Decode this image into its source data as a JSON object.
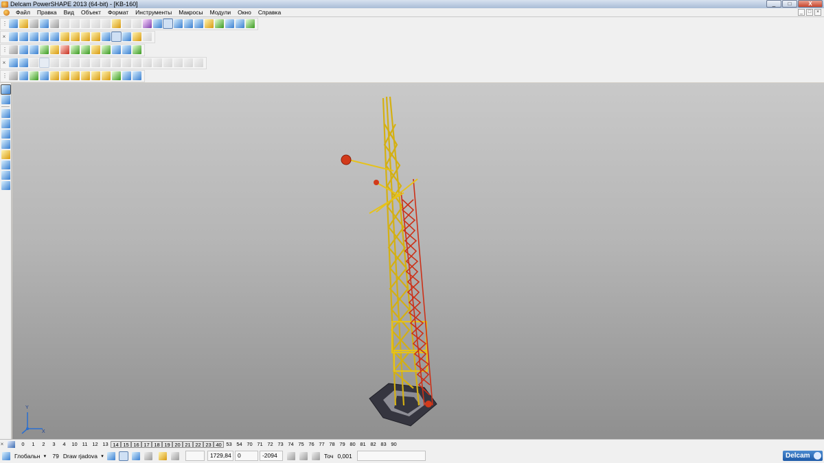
{
  "window": {
    "title": "Delcam PowerSHAPE 2013 (64-bit) - [KB-160]",
    "min": "_",
    "max": "□",
    "close": "X"
  },
  "menu": [
    "Файл",
    "Правка",
    "Вид",
    "Объект",
    "Формат",
    "Инструменты",
    "Макросы",
    "Модули",
    "Окно",
    "Справка"
  ],
  "doc_buttons": [
    "_",
    "□",
    "×"
  ],
  "levels": {
    "items": [
      "0",
      "1",
      "2",
      "3",
      "4",
      "10",
      "11",
      "12",
      "13",
      "14",
      "15",
      "16",
      "17",
      "18",
      "19",
      "20",
      "21",
      "22",
      "23",
      "40",
      "53",
      "54",
      "70",
      "71",
      "72",
      "73",
      "74",
      "75",
      "76",
      "77",
      "78",
      "79",
      "80",
      "81",
      "82",
      "83",
      "90"
    ],
    "active": [
      "14",
      "15",
      "16",
      "17",
      "18",
      "19",
      "20",
      "21",
      "22",
      "23",
      "40"
    ]
  },
  "status": {
    "workplane": "Глобальн",
    "level_num": "79",
    "level_name": "Draw rjadova",
    "coord_x": "1729,84",
    "coord_y": "0",
    "coord_z": "-2094",
    "tolerance_label": "Точ",
    "tolerance": "0,001",
    "brand": "Delcam"
  },
  "axis": {
    "y": "Y",
    "x": "X"
  },
  "colors": {
    "boom": "#e6c21a",
    "jib": "#d23a1a",
    "base": "#3a3a48"
  }
}
